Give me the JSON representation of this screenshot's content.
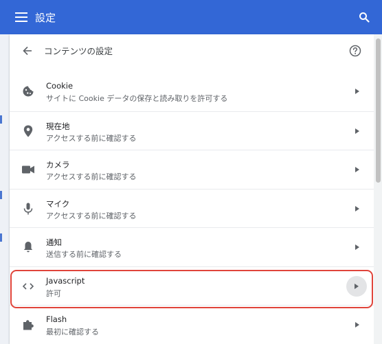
{
  "topbar": {
    "title": "設定",
    "menu_icon": "hamburger-menu-icon",
    "search_icon": "search-icon",
    "background": "#3367d6"
  },
  "page": {
    "title": "コンテンツの設定",
    "back_icon": "arrow-back-icon",
    "help_icon": "help-circle-icon"
  },
  "items": [
    {
      "title": "Cookie",
      "subtitle": "サイトに Cookie データの保存と読み取りを許可する",
      "icon": "cookie-icon"
    },
    {
      "title": "現在地",
      "subtitle": "アクセスする前に確認する",
      "icon": "location-pin-icon"
    },
    {
      "title": "カメラ",
      "subtitle": "アクセスする前に確認する",
      "icon": "camera-icon"
    },
    {
      "title": "マイク",
      "subtitle": "アクセスする前に確認する",
      "icon": "microphone-icon"
    },
    {
      "title": "通知",
      "subtitle": "送信する前に確認する",
      "icon": "bell-icon"
    },
    {
      "title": "Javascript",
      "subtitle": "許可",
      "icon": "code-brackets-icon"
    },
    {
      "title": "Flash",
      "subtitle": "最初に確認する",
      "icon": "puzzle-icon"
    }
  ],
  "highlight_color": "#e0443a"
}
